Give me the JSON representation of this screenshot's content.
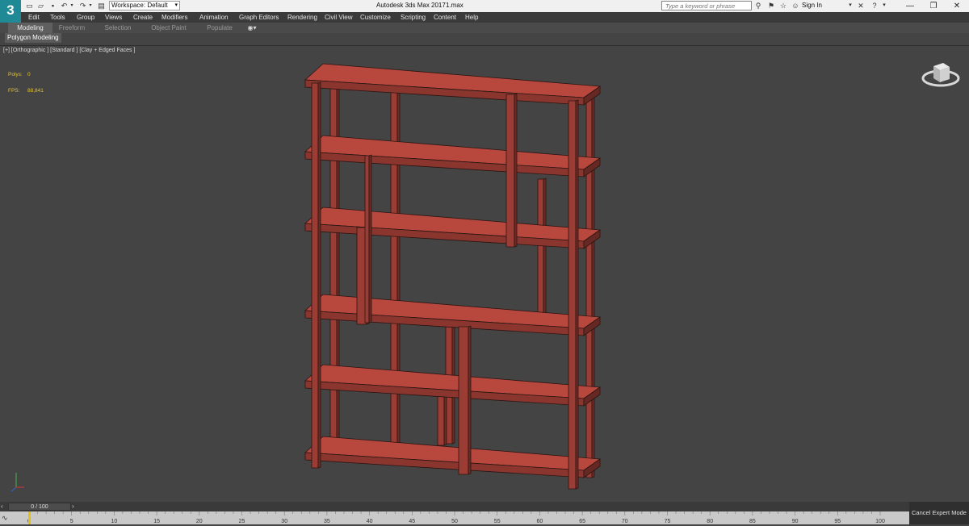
{
  "app": {
    "logo_glyph": "3",
    "title": "Autodesk 3ds Max 2017",
    "file": "1.max"
  },
  "quick_access": {
    "icons": [
      "new-file-icon",
      "open-file-icon",
      "save-icon",
      "undo-icon",
      "undo-dropdown-icon",
      "redo-icon",
      "redo-dropdown-icon",
      "project-folder-icon"
    ]
  },
  "workspace": {
    "label": "Workspace: Default"
  },
  "search": {
    "placeholder": "Type a keyword or phrase"
  },
  "account": {
    "sign_in": "Sign In"
  },
  "menu": [
    "Edit",
    "Tools",
    "Group",
    "Views",
    "Create",
    "Modifiers",
    "Animation",
    "Graph Editors",
    "Rendering",
    "Civil View",
    "Customize",
    "Scripting",
    "Content",
    "Help"
  ],
  "ribbon": {
    "tabs": [
      "Modeling",
      "Freeform",
      "Selection",
      "Object Paint",
      "Populate"
    ],
    "active": "Modeling",
    "panel": "Polygon Modeling"
  },
  "viewport": {
    "label": "[+] [Orthographic ] [Standard ] [Clay + Edged Faces ]",
    "stats": {
      "polys_label": "Polys:",
      "polys_value": "0",
      "fps_label": "FPS:",
      "fps_value": "88,841"
    },
    "object_color": "#b8483e"
  },
  "timeline": {
    "frame_display": "0 / 100",
    "current_frame": 0,
    "total_frames": 100,
    "tick_labels": [
      "0",
      "5",
      "10",
      "15",
      "20",
      "25",
      "30",
      "35",
      "40",
      "45",
      "50",
      "55",
      "60",
      "65",
      "70",
      "75",
      "80",
      "85",
      "90",
      "95",
      "100"
    ]
  },
  "status": {
    "cancel_expert": "Cancel Expert Mode"
  }
}
